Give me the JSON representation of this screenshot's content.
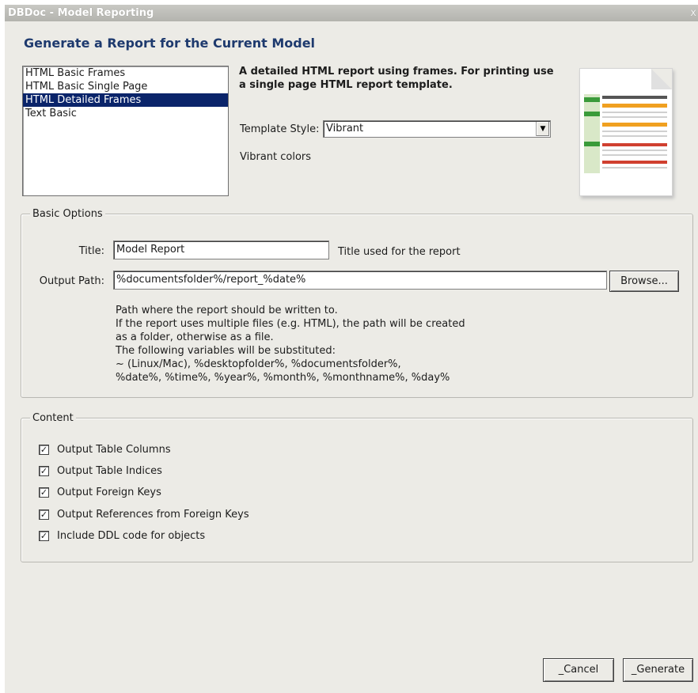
{
  "window": {
    "title": "DBDoc - Model Reporting",
    "close_glyph": "x",
    "heading": "Generate a Report for the Current Model"
  },
  "templates": {
    "items": [
      {
        "label": "HTML Basic Frames",
        "selected": false
      },
      {
        "label": "HTML Basic Single Page",
        "selected": false
      },
      {
        "label": "HTML Detailed Frames",
        "selected": true
      },
      {
        "label": "Text Basic",
        "selected": false
      }
    ],
    "description": "A detailed HTML report using frames. For printing use a single page HTML report template.",
    "style_label": "Template Style:",
    "style_value": "Vibrant",
    "style_note": "Vibrant colors",
    "preview_icon": "report-preview-thumbnail"
  },
  "basic_options": {
    "legend": "Basic Options",
    "title_label": "Title:",
    "title_value": "Model Report",
    "title_hint": "Title used for the report",
    "path_label": "Output Path:",
    "path_value": "%documentsfolder%/report_%date%",
    "browse_label": "Browse...",
    "path_help": [
      "Path where the report should be written to.",
      "If the report uses multiple files (e.g. HTML), the path will be created",
      "as a folder, otherwise as a file.",
      "The following variables will be substituted:",
      "~ (Linux/Mac), %desktopfolder%, %documentsfolder%,",
      "%date%, %time%, %year%, %month%, %monthname%, %day%"
    ]
  },
  "content": {
    "legend": "Content",
    "options": [
      {
        "label": "Output Table Columns",
        "checked": true
      },
      {
        "label": "Output Table Indices",
        "checked": true
      },
      {
        "label": "Output Foreign Keys",
        "checked": true
      },
      {
        "label": "Output References from Foreign Keys",
        "checked": true
      },
      {
        "label": "Include DDL code for objects",
        "checked": true
      }
    ]
  },
  "buttons": {
    "cancel": "_Cancel",
    "generate": "_Generate"
  },
  "colors": {
    "selection": "#0a246a",
    "heading": "#1e3a6e",
    "window_bg": "#ecebe6"
  }
}
